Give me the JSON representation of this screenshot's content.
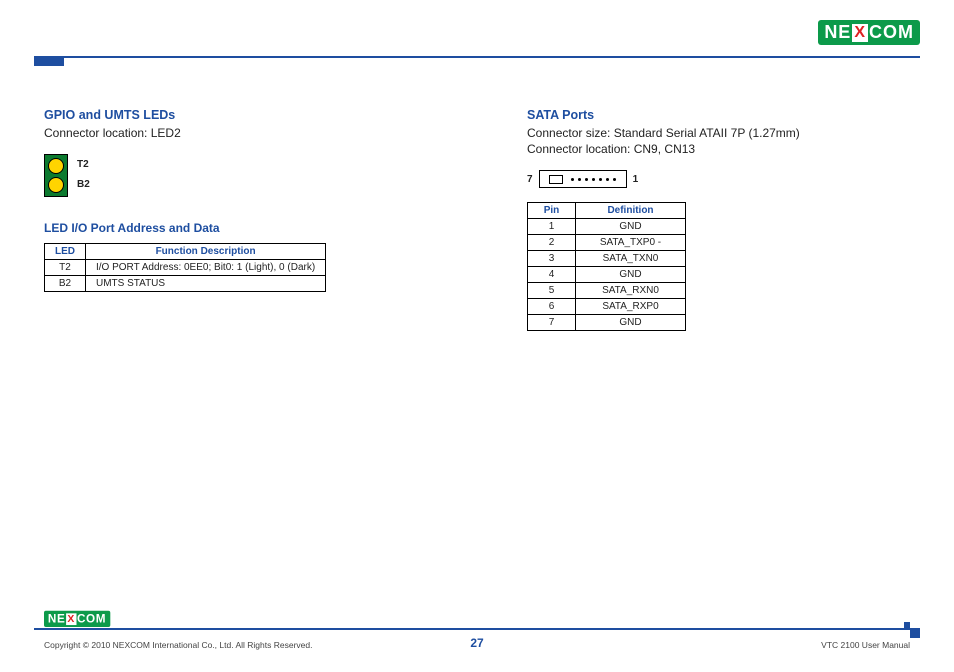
{
  "brand": {
    "left": "NE",
    "mid": "X",
    "right": "COM"
  },
  "left": {
    "title": "GPIO and UMTS LEDs",
    "connector": "Connector location: LED2",
    "labels": {
      "t2": "T2",
      "b2": "B2"
    },
    "subhead": "LED I/O Port Address and Data",
    "table": {
      "headers": [
        "LED",
        "Function Description"
      ],
      "rows": [
        [
          "T2",
          "I/O PORT Address: 0EE0; Bit0: 1 (Light), 0 (Dark)"
        ],
        [
          "B2",
          "UMTS STATUS"
        ]
      ]
    }
  },
  "right": {
    "title": "SATA Ports",
    "size": "Connector size: Standard Serial ATAII 7P (1.27mm)",
    "location": "Connector location: CN9, CN13",
    "pinLeft": "7",
    "pinRight": "1",
    "table": {
      "headers": [
        "Pin",
        "Definition"
      ],
      "rows": [
        [
          "1",
          "GND"
        ],
        [
          "2",
          "SATA_TXP0 -"
        ],
        [
          "3",
          "SATA_TXN0"
        ],
        [
          "4",
          "GND"
        ],
        [
          "5",
          "SATA_RXN0"
        ],
        [
          "6",
          "SATA_RXP0"
        ],
        [
          "7",
          "GND"
        ]
      ]
    }
  },
  "footer": {
    "copyright": "Copyright © 2010 NEXCOM International Co., Ltd. All Rights Reserved.",
    "page": "27",
    "doc": "VTC 2100 User Manual"
  }
}
